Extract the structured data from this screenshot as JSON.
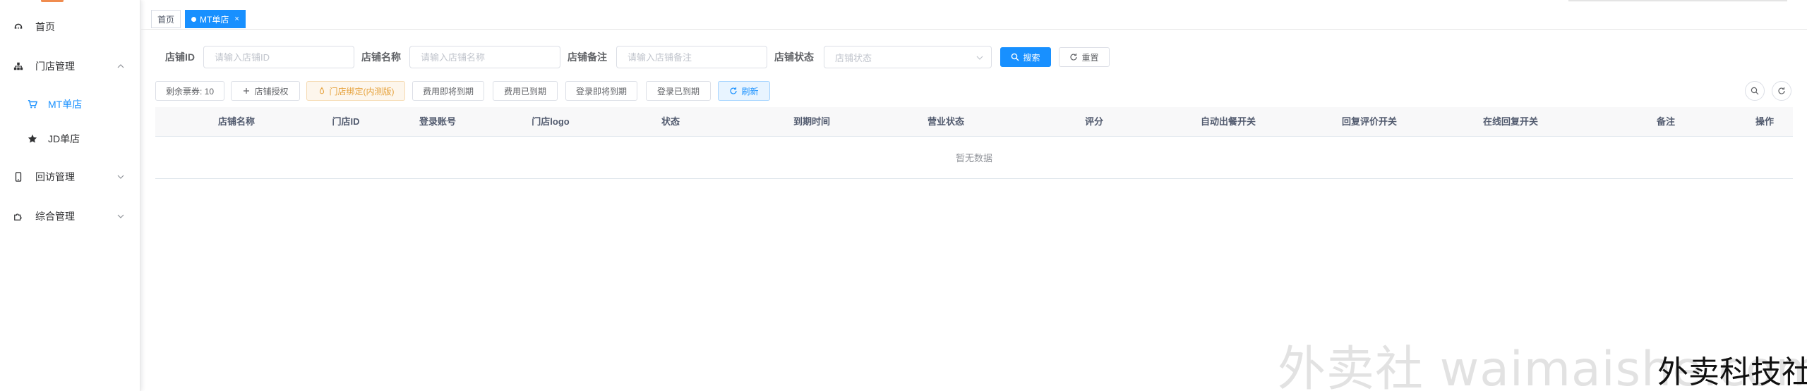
{
  "sidebar": {
    "home": "首页",
    "store_mgmt": "门店管理",
    "mt_store": "MT单店",
    "jd_store": "JD单店",
    "revisit_mgmt": "回访管理",
    "general_mgmt": "综合管理"
  },
  "tags": {
    "home": "首页",
    "mt": "MT单店",
    "close": "×"
  },
  "search": {
    "store_id_label": "店铺ID",
    "store_id_placeholder": "请输入店铺ID",
    "store_name_label": "店铺名称",
    "store_name_placeholder": "请输入店铺名称",
    "store_note_label": "店铺备注",
    "store_note_placeholder": "请输入店铺备注",
    "store_status_label": "店铺状态",
    "store_status_placeholder": "店铺状态",
    "search_button": "搜索",
    "reset_button": "重置"
  },
  "toolbar": {
    "remaining_votes": "剩余票券: 10",
    "store_auth": "店铺授权",
    "store_bind": "门店绑定(内测版)",
    "fee_expiring": "费用即将到期",
    "fee_expired": "费用已到期",
    "login_expiring": "登录即将到期",
    "login_expired": "登录已到期",
    "refresh": "刷新"
  },
  "table": {
    "columns": [
      "店铺名称",
      "门店ID",
      "登录账号",
      "门店logo",
      "状态",
      "到期时间",
      "营业状态",
      "评分",
      "自动出餐开关",
      "回复评价开关",
      "在线回复开关",
      "备注",
      "操作"
    ],
    "empty_text": "暂无数据"
  },
  "watermark": {
    "text": "外卖社 waimaishe.com",
    "overlay": "外卖科技社"
  },
  "colors": {
    "primary": "#1890ff",
    "warning": "#e6a23c"
  }
}
